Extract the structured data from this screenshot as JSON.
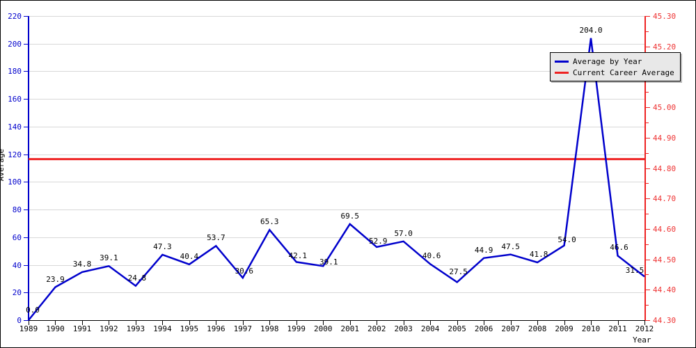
{
  "chart_data": {
    "type": "line",
    "title": "",
    "xlabel": "Year",
    "ylabel": "Average",
    "ylabel_right": "",
    "categories": [
      "1989",
      "1990",
      "1991",
      "1992",
      "1993",
      "1994",
      "1995",
      "1996",
      "1997",
      "1998",
      "1999",
      "2000",
      "2001",
      "2002",
      "2003",
      "2004",
      "2005",
      "2006",
      "2007",
      "2008",
      "2009",
      "2010",
      "2011",
      "2012"
    ],
    "series": [
      {
        "name": "Average by Year",
        "color": "#0000cc",
        "values": [
          0.0,
          23.9,
          34.8,
          39.1,
          24.8,
          47.3,
          40.4,
          53.7,
          30.6,
          65.3,
          42.1,
          39.1,
          69.5,
          52.9,
          57.0,
          40.6,
          27.5,
          44.9,
          47.5,
          41.8,
          54.0,
          204.0,
          46.6,
          31.5
        ],
        "point_labels": [
          "0.0",
          "23.9",
          "34.8",
          "39.1",
          "24.8",
          "47.3",
          "40.4",
          "53.7",
          "30.6",
          "65.3",
          "42.1",
          "39.1",
          "69.5",
          "52.9",
          "57.0",
          "40.6",
          "27.5",
          "44.9",
          "47.5",
          "41.8",
          "54.0",
          "204.0",
          "46.6",
          "31.5"
        ]
      },
      {
        "name": "Current Career Average",
        "color": "#ee2222",
        "type": "hline",
        "value": 116.5
      }
    ],
    "ylim": [
      0,
      220
    ],
    "yticks": [
      0,
      20,
      40,
      60,
      80,
      100,
      120,
      140,
      160,
      180,
      200,
      220
    ],
    "ytick_labels": [
      "0",
      "20",
      "40",
      "60",
      "80",
      "100",
      "120",
      "140",
      "160",
      "180",
      "200",
      "220"
    ],
    "ylim_right": [
      44.3,
      45.3
    ],
    "yticks_right": [
      44.3,
      44.4,
      44.5,
      44.6,
      44.7,
      44.8,
      44.9,
      45.0,
      45.1,
      45.2,
      45.3
    ],
    "ytick_labels_right": [
      "44.30",
      "44.40",
      "44.50",
      "44.60",
      "44.70",
      "44.80",
      "44.90",
      "45.00",
      "45.10",
      "45.20",
      "45.30"
    ],
    "ytick_minor_right": [
      44.35,
      44.45,
      44.55,
      44.65,
      44.75,
      44.85,
      44.95,
      45.05,
      45.15,
      45.25
    ],
    "grid": true,
    "legend_position": "top-right",
    "axis_color_left": "#0000cc",
    "axis_color_right": "#ee2222"
  },
  "legend": {
    "items": [
      {
        "label": "Average by Year",
        "color": "#0000cc"
      },
      {
        "label": "Current Career Average",
        "color": "#ee2222"
      }
    ]
  },
  "axes": {
    "y_title": "Average",
    "x_title": "Year"
  }
}
